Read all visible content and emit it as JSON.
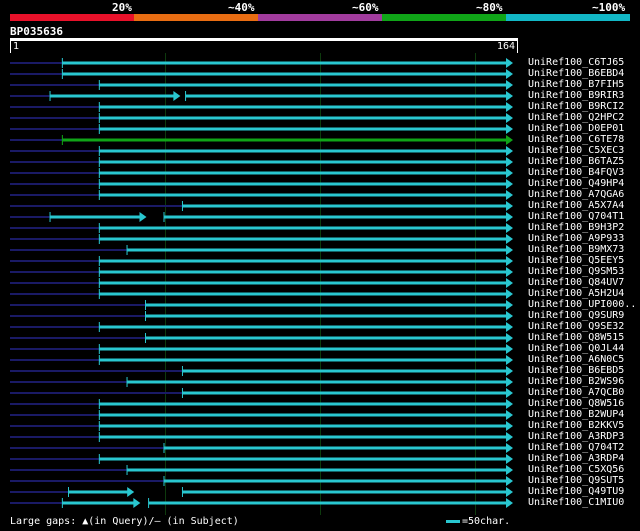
{
  "legend": {
    "labels": [
      "20%",
      "~40%",
      "~60%",
      "~80%",
      "~100%"
    ],
    "colors": [
      "#e8112a",
      "#e96d12",
      "#a23c9e",
      "#10a518",
      "#12b7c6"
    ]
  },
  "query": {
    "name": "BP035636",
    "start": "1",
    "end": "164"
  },
  "colors": {
    "hit": "#29c7d0",
    "hit_green": "#10a518",
    "faint": "#1a1a66",
    "grid": "#0d3a0d"
  },
  "hits": [
    {
      "label": "UniRef100_C6TJ65",
      "qs": 18,
      "qe": 164,
      "color": "cyan",
      "gap": null
    },
    {
      "label": "UniRef100_B6EBD4",
      "qs": 18,
      "qe": 164,
      "color": "cyan",
      "gap": null
    },
    {
      "label": "UniRef100_B7FIH5",
      "qs": 30,
      "qe": 164,
      "color": "cyan",
      "gap": null
    },
    {
      "label": "UniRef100_B9RIR3",
      "qs": 14,
      "qe": 164,
      "color": "cyan",
      "gap": [
        56,
        58
      ]
    },
    {
      "label": "UniRef100_B9RCI2",
      "qs": 30,
      "qe": 164,
      "color": "cyan",
      "gap": null
    },
    {
      "label": "UniRef100_Q2HPC2",
      "qs": 30,
      "qe": 164,
      "color": "cyan",
      "gap": null
    },
    {
      "label": "UniRef100_D0EP01",
      "qs": 30,
      "qe": 164,
      "color": "cyan",
      "gap": null
    },
    {
      "label": "UniRef100_C6TE78",
      "qs": 18,
      "qe": 164,
      "color": "green",
      "gap": null
    },
    {
      "label": "UniRef100_C5XEC3",
      "qs": 30,
      "qe": 164,
      "color": "cyan",
      "gap": null
    },
    {
      "label": "UniRef100_B6TAZ5",
      "qs": 30,
      "qe": 164,
      "color": "cyan",
      "gap": null
    },
    {
      "label": "UniRef100_B4FQV3",
      "qs": 30,
      "qe": 164,
      "color": "cyan",
      "gap": null
    },
    {
      "label": "UniRef100_Q49HP4",
      "qs": 30,
      "qe": 164,
      "color": "cyan",
      "gap": null
    },
    {
      "label": "UniRef100_A7QGA6",
      "qs": 30,
      "qe": 164,
      "color": "cyan",
      "gap": null
    },
    {
      "label": "UniRef100_A5X7A4",
      "qs": 57,
      "qe": 164,
      "color": "cyan",
      "gap": null
    },
    {
      "label": "UniRef100_Q704T1",
      "qs": 14,
      "qe": 164,
      "color": "cyan",
      "gap": [
        45,
        51
      ]
    },
    {
      "label": "UniRef100_B9H3P2",
      "qs": 30,
      "qe": 164,
      "color": "cyan",
      "gap": null
    },
    {
      "label": "UniRef100_A9P933",
      "qs": 30,
      "qe": 164,
      "color": "cyan",
      "gap": null
    },
    {
      "label": "UniRef100_B9MX73",
      "qs": 39,
      "qe": 164,
      "color": "cyan",
      "gap": null
    },
    {
      "label": "UniRef100_Q5EEY5",
      "qs": 30,
      "qe": 164,
      "color": "cyan",
      "gap": null
    },
    {
      "label": "UniRef100_Q9SM53",
      "qs": 30,
      "qe": 164,
      "color": "cyan",
      "gap": null
    },
    {
      "label": "UniRef100_Q84UV7",
      "qs": 30,
      "qe": 164,
      "color": "cyan",
      "gap": null
    },
    {
      "label": "UniRef100_A5H2U4",
      "qs": 30,
      "qe": 164,
      "color": "cyan",
      "gap": null
    },
    {
      "label": "UniRef100_UPI000..",
      "qs": 45,
      "qe": 164,
      "color": "cyan",
      "gap": null
    },
    {
      "label": "UniRef100_Q9SUR9",
      "qs": 45,
      "qe": 164,
      "color": "cyan",
      "gap": null
    },
    {
      "label": "UniRef100_Q9SE32",
      "qs": 30,
      "qe": 164,
      "color": "cyan",
      "gap": null
    },
    {
      "label": "UniRef100_Q8W515",
      "qs": 45,
      "qe": 164,
      "color": "cyan",
      "gap": null
    },
    {
      "label": "UniRef100_Q0JL44",
      "qs": 30,
      "qe": 164,
      "color": "cyan",
      "gap": null
    },
    {
      "label": "UniRef100_A6N0C5",
      "qs": 30,
      "qe": 164,
      "color": "cyan",
      "gap": null
    },
    {
      "label": "UniRef100_B6EBD5",
      "qs": 57,
      "qe": 164,
      "color": "cyan",
      "gap": null
    },
    {
      "label": "UniRef100_B2WS96",
      "qs": 39,
      "qe": 164,
      "color": "cyan",
      "gap": null
    },
    {
      "label": "UniRef100_A7QCB0",
      "qs": 57,
      "qe": 164,
      "color": "cyan",
      "gap": null
    },
    {
      "label": "UniRef100_Q8W516",
      "qs": 30,
      "qe": 164,
      "color": "cyan",
      "gap": null
    },
    {
      "label": "UniRef100_B2WUP4",
      "qs": 30,
      "qe": 164,
      "color": "cyan",
      "gap": null
    },
    {
      "label": "UniRef100_B2KKV5",
      "qs": 30,
      "qe": 164,
      "color": "cyan",
      "gap": null
    },
    {
      "label": "UniRef100_A3RDP3",
      "qs": 30,
      "qe": 164,
      "color": "cyan",
      "gap": null
    },
    {
      "label": "UniRef100_Q704T2",
      "qs": 51,
      "qe": 164,
      "color": "cyan",
      "gap": null
    },
    {
      "label": "UniRef100_A3RDP4",
      "qs": 30,
      "qe": 164,
      "color": "cyan",
      "gap": null
    },
    {
      "label": "UniRef100_C5XQ56",
      "qs": 39,
      "qe": 164,
      "color": "cyan",
      "gap": null
    },
    {
      "label": "UniRef100_Q9SUT5",
      "qs": 51,
      "qe": 164,
      "color": "cyan",
      "gap": null
    },
    {
      "label": "UniRef100_Q49TU9",
      "qs": 20,
      "qe": 164,
      "color": "cyan",
      "gap": [
        41,
        57
      ]
    },
    {
      "label": "UniRef100_C1MIU0",
      "qs": 18,
      "qe": 164,
      "color": "cyan",
      "gap": [
        43,
        46
      ]
    }
  ],
  "footer": {
    "gap_text": "Large gaps: ▲(in Query)/– (in Subject)",
    "scale_text": "=50char."
  }
}
